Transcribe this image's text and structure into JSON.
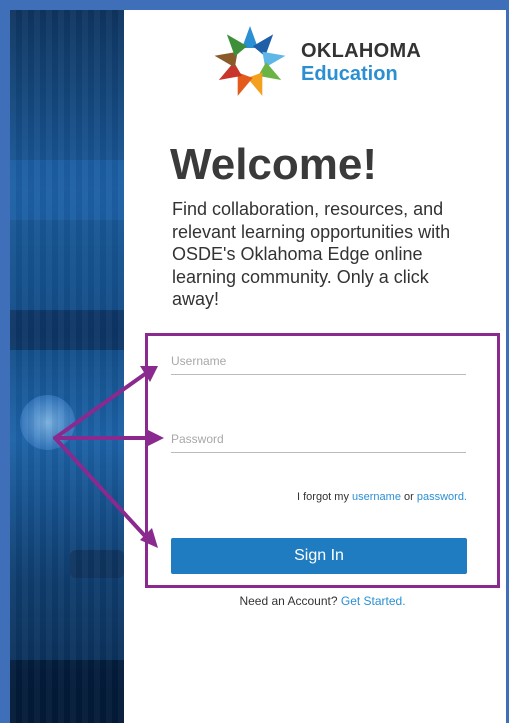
{
  "logo": {
    "line1": "OKLAHOMA",
    "line2": "Education"
  },
  "welcome": {
    "heading": "Welcome!",
    "intro": "Find collaboration, resources, and relevant learning opportunities with OSDE's Oklahoma Edge online learning community. Only a click away!"
  },
  "login": {
    "username_placeholder": "Username",
    "password_placeholder": "Password",
    "forgot_prefix": "I forgot my ",
    "forgot_username": "username",
    "forgot_or": " or ",
    "forgot_password": "password.",
    "sign_in_label": "Sign In"
  },
  "signup": {
    "prompt": "Need an Account? ",
    "link": "Get Started."
  },
  "colors": {
    "frame": "#3f6fb8",
    "button": "#1f7cc1",
    "link": "#2b8fd3",
    "annotation": "#8a2a8f"
  },
  "icons": {
    "logo": "star-burst-logo-icon",
    "annotation": "arrow-annotation-icon"
  }
}
